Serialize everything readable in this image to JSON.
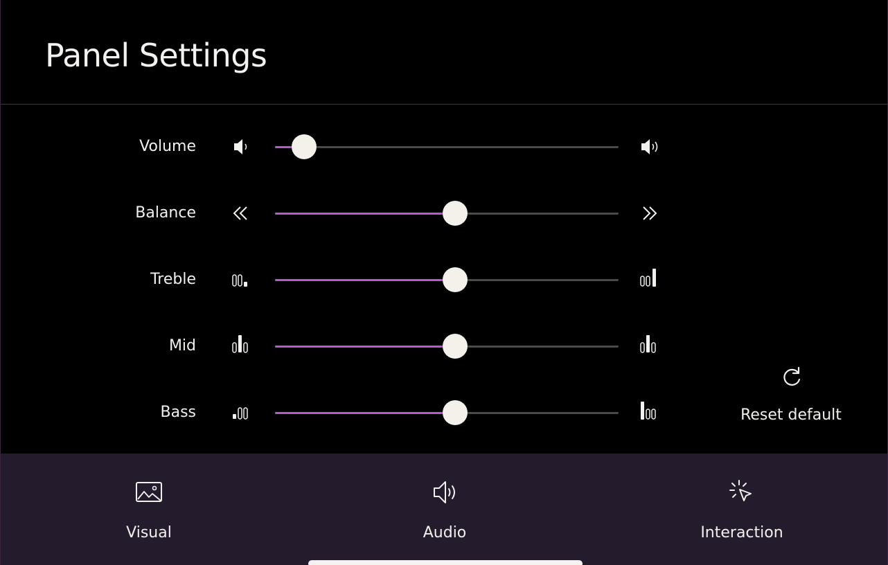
{
  "header": {
    "title": "Panel Settings"
  },
  "sliders": [
    {
      "label": "Volume",
      "value": 0.06,
      "icon_left": "volume-low-icon",
      "icon_right": "volume-high-icon"
    },
    {
      "label": "Balance",
      "value": 0.5,
      "icon_left": "chevron-double-left-icon",
      "icon_right": "chevron-double-right-icon"
    },
    {
      "label": "Treble",
      "value": 0.5,
      "icon_left": "treble-low-icon",
      "icon_right": "treble-high-icon"
    },
    {
      "label": "Mid",
      "value": 0.5,
      "icon_left": "mid-low-icon",
      "icon_right": "mid-high-icon"
    },
    {
      "label": "Bass",
      "value": 0.5,
      "icon_left": "bass-low-icon",
      "icon_right": "bass-high-icon"
    }
  ],
  "reset": {
    "label": "Reset default",
    "icon": "refresh-icon"
  },
  "tabs": [
    {
      "label": "Visual",
      "icon": "image-icon"
    },
    {
      "label": "Audio",
      "icon": "speaker-icon"
    },
    {
      "label": "Interaction",
      "icon": "pointer-click-icon"
    }
  ],
  "colors": {
    "background": "#000000",
    "accent": "#b65ad0",
    "track": "#4c4a48",
    "thumb": "#f4f1ea",
    "tabbar": "#241c2c",
    "text": "#f2f0ec"
  }
}
